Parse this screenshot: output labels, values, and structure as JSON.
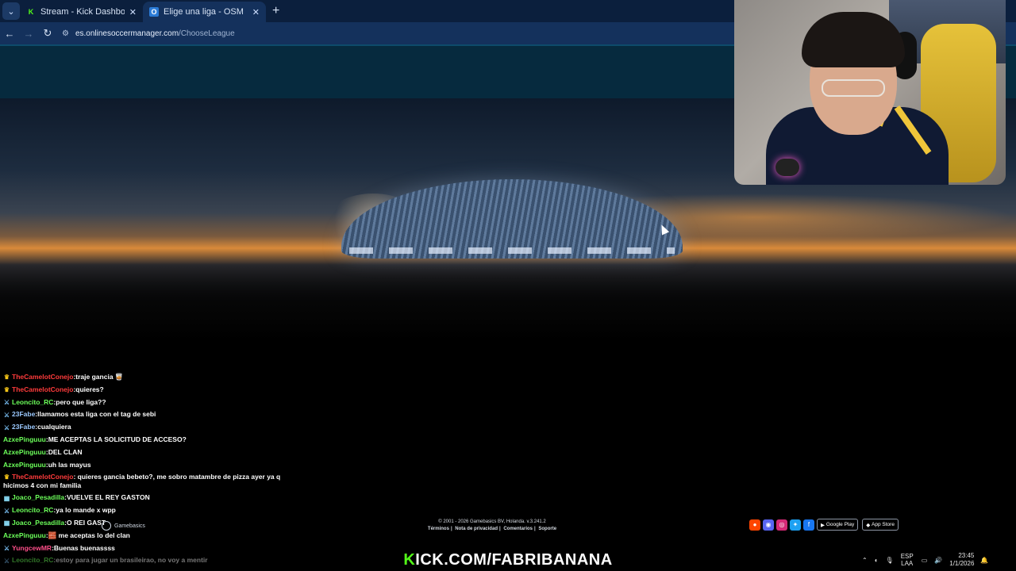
{
  "browser": {
    "tabs": [
      {
        "title": "Stream - Kick Dashboard",
        "active": false,
        "favicon": "K"
      },
      {
        "title": "Elige una liga - OSM",
        "active": true,
        "favicon": "O"
      }
    ],
    "url_host": "es.onlinesoccermanager.com",
    "url_path": "/ChooseLeague"
  },
  "chat": [
    {
      "badge": "crown-icon",
      "user": "TheCamelotConejo",
      "color": "#ff3b3b",
      "msg": "traje gancia 🥃"
    },
    {
      "badge": "crown-icon",
      "user": "TheCamelotConejo",
      "color": "#ff3b3b",
      "msg": "quieres?"
    },
    {
      "badge": "sword-icon",
      "user": "Leoncito_RC",
      "color": "#6cff5a",
      "msg": "pero que liga??"
    },
    {
      "badge": "sword-icon",
      "user": "23Fabe",
      "color": "#9bc9ff",
      "msg": "llamamos esta liga con el tag de sebi"
    },
    {
      "badge": "sword-icon",
      "user": "23Fabe",
      "color": "#9bc9ff",
      "msg": "cualquiera"
    },
    {
      "badge": "",
      "user": "AzxePinguuu",
      "color": "#6cff5a",
      "msg": "ME ACEPTAS LA SOLICITUD DE ACCESO?"
    },
    {
      "badge": "",
      "user": "AzxePinguuu",
      "color": "#6cff5a",
      "msg": "DEL CLAN"
    },
    {
      "badge": "",
      "user": "AzxePinguuu",
      "color": "#6cff5a",
      "msg": "uh las mayus"
    },
    {
      "badge": "crown-icon",
      "user": "TheCamelotConejo",
      "color": "#ff3b3b",
      "msg": "quieres gancia bebeto?, me sobro matambre de pizza ayer ya q hicimos 4 con mi familia",
      "wrap": true
    },
    {
      "badge": "box-icon",
      "user": "Joaco_Pesadilla",
      "color": "#6cff5a",
      "msg": "VUELVE EL REY GASTON"
    },
    {
      "badge": "sword-icon",
      "user": "Leoncito_RC",
      "color": "#6cff5a",
      "msg": "ya lo mande x wpp"
    },
    {
      "badge": "box-icon",
      "user": "Joaco_Pesadilla",
      "color": "#6cff5a",
      "msg": "O REI GAST"
    },
    {
      "badge": "",
      "user": "AzxePinguuu",
      "color": "#6cff5a",
      "msg": "🧱 me aceptas lo del clan"
    },
    {
      "badge": "sword-icon",
      "user": "YungcewMR",
      "color": "#ff4f8a",
      "msg": "Buenas buenassss"
    },
    {
      "badge": "sword-icon",
      "user": "Leoncito_RC",
      "color": "#6cff5a",
      "msg": "estoy para jugar un brasileirao, no voy a mentir",
      "dim": true
    }
  ],
  "footer": {
    "copyright": "© 2001 - 2026 Gamebasics BV, Holanda. v.3.241.2",
    "links": [
      "Términos",
      "Nota de privacidad",
      "Comentarios",
      "Soporte"
    ],
    "gamebasics": "Gamebasics",
    "google_play": "Google Play",
    "app_store": "App Store"
  },
  "overlay": {
    "kick_k": "K",
    "kick_rest": "ICK.COM/FABRIBANANA"
  },
  "taskbar": {
    "lang_top": "ESP",
    "lang_bottom": "LAA",
    "time": "23:45",
    "date": "1/1/2026"
  },
  "colors": {
    "kick_green": "#53fc18",
    "chrome_dark": "#0b1f3d",
    "chrome_mid": "#14315c",
    "site_header": "#062a3e"
  }
}
